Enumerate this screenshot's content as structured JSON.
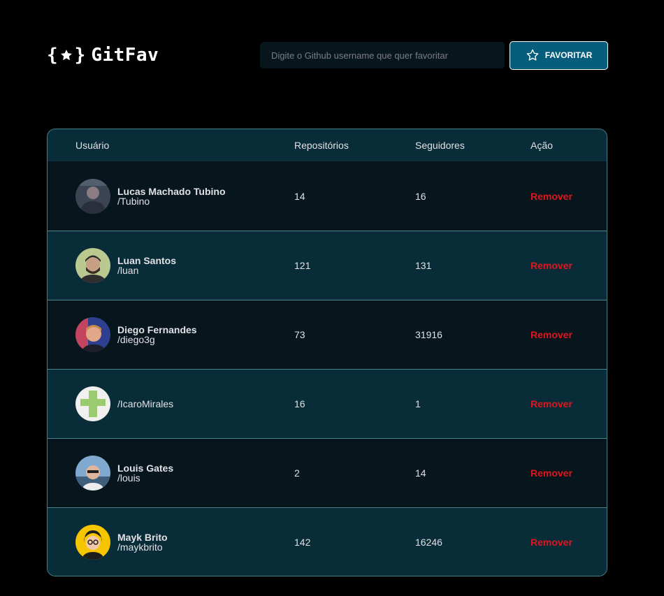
{
  "header": {
    "logo_text": "GitFav",
    "search_placeholder": "Digite o Github username que quer favoritar",
    "search_value": "",
    "favorite_label": "FAVORITAR"
  },
  "table": {
    "headers": {
      "user": "Usuário",
      "repos": "Repositórios",
      "followers": "Seguidores",
      "action": "Ação"
    },
    "rows": [
      {
        "name": "Lucas Machado Tubino",
        "login": "/Tubino",
        "repos": "14",
        "followers": "16",
        "action": "Remover"
      },
      {
        "name": "Luan Santos",
        "login": "/luan",
        "repos": "121",
        "followers": "131",
        "action": "Remover"
      },
      {
        "name": "Diego Fernandes",
        "login": "/diego3g",
        "repos": "73",
        "followers": "31916",
        "action": "Remover"
      },
      {
        "name": "",
        "login": "/IcaroMirales",
        "repos": "16",
        "followers": "1",
        "action": "Remover"
      },
      {
        "name": "Louis Gates",
        "login": "/louis",
        "repos": "2",
        "followers": "14",
        "action": "Remover"
      },
      {
        "name": "Mayk Brito",
        "login": "/maykbrito",
        "repos": "142",
        "followers": "16246",
        "action": "Remover"
      }
    ]
  },
  "icons": {
    "logo": "braces-star-icon",
    "favorite": "star-outline-icon"
  },
  "colors": {
    "background": "#000000",
    "accent": "#065E7C",
    "table_header": "#092D38",
    "row_dark": "#06161C",
    "row_light": "#092D38",
    "remove": "#E0161F"
  }
}
